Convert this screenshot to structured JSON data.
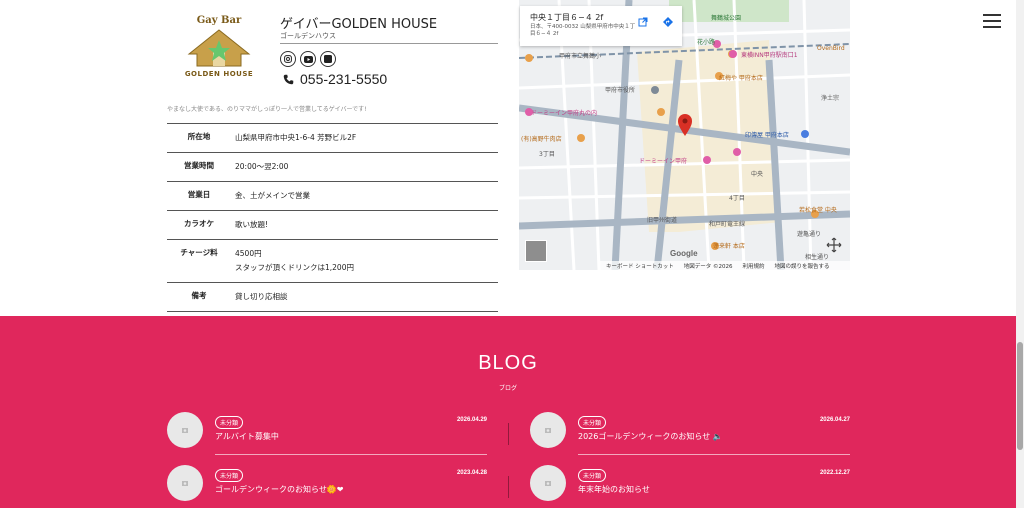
{
  "shop": {
    "logo_text_top": "Gay Bar",
    "logo_text_bottom": "GOLDEN HOUSE",
    "name": "ゲイバーGOLDEN HOUSE",
    "kana": "ゴールデンハウス",
    "phone": "055-231-5550",
    "tagline": "やまなし大使である、のりママがしっぽり一人で営業してるゲイバーです!",
    "sns_icons": [
      "instagram-icon",
      "youtube-icon",
      "x-icon"
    ]
  },
  "info": {
    "rows": [
      {
        "label": "所在地",
        "value": [
          "山梨県甲府市中央1-6-4 芳野ビル2F"
        ]
      },
      {
        "label": "営業時間",
        "value": [
          "20:00〜翌2:00"
        ]
      },
      {
        "label": "営業日",
        "value": [
          "金、土がメインで営業"
        ]
      },
      {
        "label": "カラオケ",
        "value": [
          "歌い放題!"
        ]
      },
      {
        "label": "チャージ料",
        "value": [
          "4500円",
          "スタッフが頂くドリンクは1,200円"
        ]
      },
      {
        "label": "備考",
        "value": [
          "貸し切り応相談"
        ]
      }
    ]
  },
  "map": {
    "place_title": "中央１丁目６−４ 2f",
    "place_address": "日本、〒400-0032 山梨県甲府市中央１丁目６−４ 2f",
    "google": "Google",
    "footer": [
      "キーボード ショートカット",
      "地図データ ©2026",
      "利用規約",
      "地図の誤りを報告する"
    ],
    "labels": [
      {
        "text": "舞鶴城公園"
      },
      {
        "text": "東横INN甲府駅南口1"
      },
      {
        "text": "紅梅や 甲府本店"
      },
      {
        "text": "甲府市立舞鶴小"
      },
      {
        "text": "甲府市役所"
      },
      {
        "text": "ドーミーイン甲府丸の内"
      },
      {
        "text": "(有)高野牛肉店"
      },
      {
        "text": "印傳屋 甲府本店"
      },
      {
        "text": "ドーミーイン甲府"
      },
      {
        "text": "中央"
      },
      {
        "text": "旧甲州街道"
      },
      {
        "text": "和戸町竜王線"
      },
      {
        "text": "若松食堂 中央"
      },
      {
        "text": "蓬来軒 本店"
      },
      {
        "text": "遊亀通り"
      },
      {
        "text": "相生通り"
      },
      {
        "text": "浄土宗"
      },
      {
        "text": "OvenBird"
      },
      {
        "text": "4丁目"
      },
      {
        "text": "3丁目"
      },
      {
        "text": "花小路"
      }
    ],
    "colors": {
      "road": "#c3ccd6",
      "block": "#f3ecd9",
      "pin": "#d93025",
      "poi": "#e8a04b"
    }
  },
  "blog": {
    "title": "BLOG",
    "subtitle": "ブログ",
    "posts": [
      {
        "category": "未分類",
        "date": "2026.04.29",
        "title": "アルバイト募集中"
      },
      {
        "category": "未分類",
        "date": "2026.04.27",
        "title": "2026ゴールデンウィークのお知らせ 🔈"
      },
      {
        "category": "未分類",
        "date": "2023.04.28",
        "title": "ゴールデンウィークのお知らせ🌼❤"
      },
      {
        "category": "未分類",
        "date": "2022.12.27",
        "title": "年末年始のお知らせ"
      }
    ],
    "accent": "#e0275c"
  }
}
